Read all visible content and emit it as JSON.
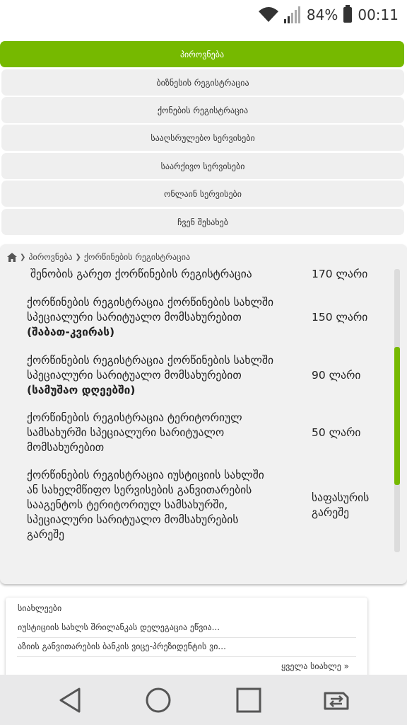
{
  "status_bar": {
    "battery": "84%",
    "time": "00:11"
  },
  "nav": {
    "items": [
      {
        "label": "პიროვნება",
        "active": true
      },
      {
        "label": "ბიზნესის რეგისტრაცია"
      },
      {
        "label": "ქონების რეგისტრაცია"
      },
      {
        "label": "სააღსრულებო სერვისები"
      },
      {
        "label": "საარქივო სერვისები"
      },
      {
        "label": "ონლაინ სერვისები"
      },
      {
        "label": "ჩვენ შესახებ"
      }
    ]
  },
  "breadcrumb": {
    "items": [
      "პიროვნება",
      "ქორწინების რეგისტრაცია"
    ]
  },
  "services": [
    {
      "desc_lines": [
        "შენობის გარეთ ქორწინების რეგისტრაცია"
      ],
      "price_lines": [
        "170 ლარი"
      ]
    },
    {
      "desc_lines": [
        "ქორწინების რეგისტრაცია ქორწინების სახლში",
        "სპეციალური სარიტუალო მომსახურებით"
      ],
      "desc_bold": "(შაბათ-კვირას)",
      "price_lines": [
        "150 ლარი"
      ]
    },
    {
      "desc_lines": [
        "ქორწინების რეგისტრაცია ქორწინების სახლში",
        "სპეციალური სარიტუალო მომსახურებით"
      ],
      "desc_bold": "(სამუშაო დღეებში)",
      "price_lines": [
        "90 ლარი"
      ]
    },
    {
      "desc_lines": [
        "ქორწინების რეგისტრაცია  ტერიტორიულ",
        "სამსახურში სპეციალური სარიტუალო",
        "მომსახურებით"
      ],
      "price_lines": [
        "50 ლარი"
      ]
    },
    {
      "desc_lines": [
        "ქორწინების რეგისტრაცია იუსტიციის სახლში",
        "ან სახელმწიფო სერვისების განვითარების",
        "სააგენტოს ტერიტორიულ სამსახურში,",
        "სპეციალური სარიტუალო მომსახურების",
        "გარეშე"
      ],
      "price_lines": [
        "საფასურის",
        "გარეშე"
      ]
    }
  ],
  "news": {
    "title": "სიახლეები",
    "items": [
      "იუსტიციის სახლს შრილანკას დელეგაცია ეწვია...",
      "აზიის განვითარების ბანკის ვიცე-პრეზიდენტის ვი..."
    ],
    "all_link": "ყველა სიახლე »"
  },
  "colors": {
    "accent": "#76b900"
  }
}
